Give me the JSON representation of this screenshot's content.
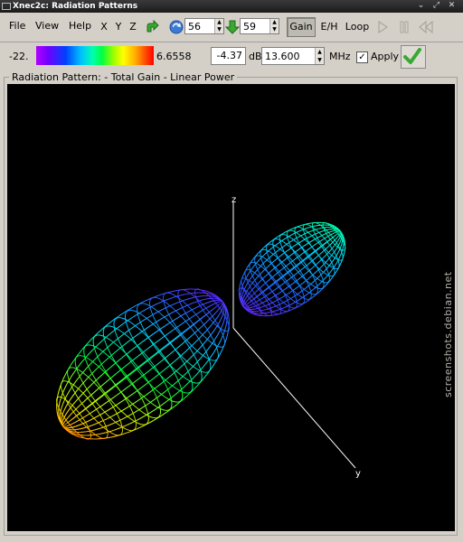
{
  "window": {
    "title": "Xnec2c: Radiation Patterns"
  },
  "menu": {
    "file": "File",
    "view": "View",
    "help": "Help"
  },
  "toolbar": {
    "axis_x": "X",
    "axis_y": "Y",
    "axis_z": "Z",
    "spin1": "56",
    "spin2": "59",
    "gain": "Gain",
    "eh": "E/H",
    "loop": "Loop"
  },
  "scale": {
    "min": "-22.",
    "max": "6.6558"
  },
  "controls": {
    "value_db": "-4.37",
    "unit_db": "dB",
    "freq": "13.600",
    "unit_freq": "MHz",
    "apply": "Apply"
  },
  "pattern": {
    "label": "Radiation Pattern: - Total Gain - Linear Power",
    "axis_z": "z",
    "axis_y": "y"
  },
  "watermark": {
    "text": "screenshots.debian.net"
  }
}
